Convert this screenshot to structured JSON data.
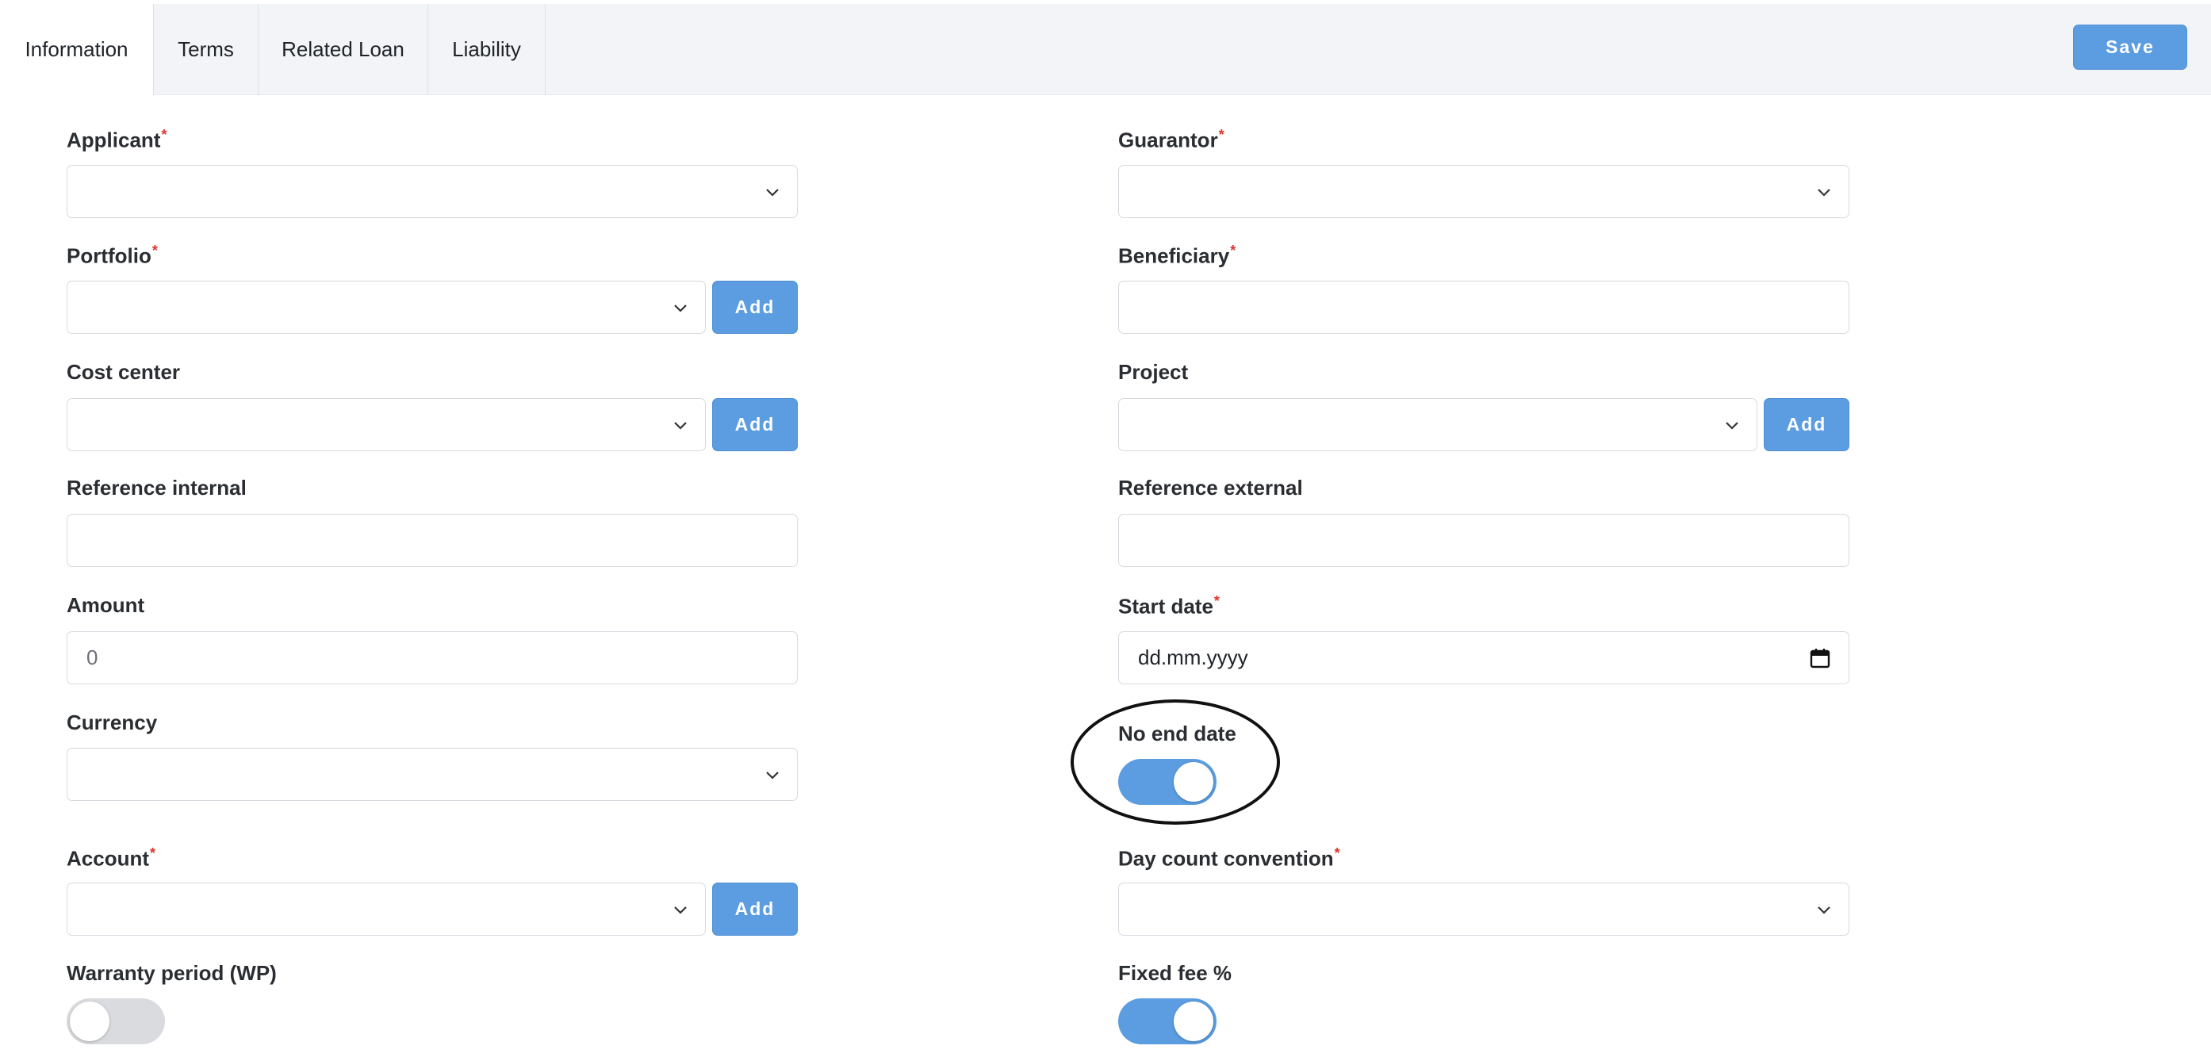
{
  "tabs": [
    {
      "label": "Information",
      "active": true
    },
    {
      "label": "Terms",
      "active": false
    },
    {
      "label": "Related Loan",
      "active": false
    },
    {
      "label": "Liability",
      "active": false
    }
  ],
  "toolbar": {
    "save_label": "Save"
  },
  "icons": {
    "dropdown": "chevron-down-icon",
    "calendar": "calendar-icon"
  },
  "colors": {
    "accent": "#5b9de0",
    "required": "#e0342c",
    "tabbar_bg": "#f2f4f7"
  },
  "form": {
    "applicant": {
      "label": "Applicant",
      "required": true,
      "value": ""
    },
    "guarantor": {
      "label": "Guarantor",
      "required": true,
      "value": ""
    },
    "portfolio": {
      "label": "Portfolio",
      "required": true,
      "value": "",
      "add_label": "Add"
    },
    "beneficiary": {
      "label": "Beneficiary",
      "required": true,
      "value": ""
    },
    "cost_center": {
      "label": "Cost center",
      "required": false,
      "value": "",
      "add_label": "Add"
    },
    "project": {
      "label": "Project",
      "required": false,
      "value": "",
      "add_label": "Add"
    },
    "reference_internal": {
      "label": "Reference internal",
      "value": ""
    },
    "reference_external": {
      "label": "Reference external",
      "value": ""
    },
    "amount": {
      "label": "Amount",
      "placeholder": "0"
    },
    "start_date": {
      "label": "Start date",
      "required": true,
      "placeholder": "dd.mm.yyyy"
    },
    "currency": {
      "label": "Currency",
      "value": ""
    },
    "no_end_date": {
      "label": "No end date",
      "on": true
    },
    "account": {
      "label": "Account",
      "required": true,
      "value": "",
      "add_label": "Add"
    },
    "day_count_convention": {
      "label": "Day count convention",
      "required": true,
      "value": ""
    },
    "warranty_period": {
      "label": "Warranty period (WP)",
      "on": false
    },
    "fixed_fee": {
      "label": "Fixed fee %",
      "on": true
    }
  },
  "required_mark": "*"
}
